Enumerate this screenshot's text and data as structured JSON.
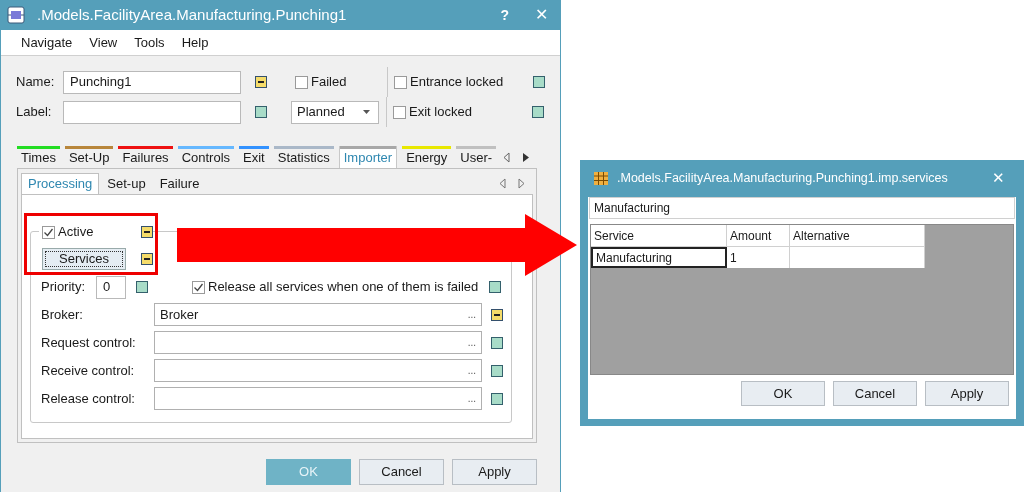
{
  "main_window": {
    "title": ".Models.FacilityArea.Manufacturing.Punching1",
    "help": "?",
    "close": "✕",
    "menu": [
      "Navigate",
      "View",
      "Tools",
      "Help"
    ],
    "name_field": {
      "label": "Name:",
      "value": "Punching1",
      "inherited": false
    },
    "label_field": {
      "label": "Label:",
      "inherited": true
    },
    "failed": {
      "label": "Failed",
      "checked": false
    },
    "state_dropdown": {
      "value": "Planned"
    },
    "entrance_locked": {
      "label": "Entrance locked",
      "checked": false,
      "inherited": true
    },
    "exit_locked": {
      "label": "Exit locked",
      "checked": false,
      "inherited": true
    },
    "tabs": [
      {
        "label": "Times",
        "color": "#22dd22",
        "selected": false
      },
      {
        "label": "Set-Up",
        "color": "#b8863b",
        "selected": false
      },
      {
        "label": "Failures",
        "color": "#ee1111",
        "selected": false
      },
      {
        "label": "Controls",
        "color": "#66b8ff",
        "selected": false
      },
      {
        "label": "Exit",
        "color": "#3392ff",
        "selected": false
      },
      {
        "label": "Statistics",
        "color": "#aab8c8",
        "selected": false
      },
      {
        "label": "Importer",
        "color": "#a8a8a8",
        "selected": true
      },
      {
        "label": "Energy",
        "color": "#e8e800",
        "selected": false
      },
      {
        "label": "User-",
        "color": "#c0c0c0",
        "selected": false
      }
    ],
    "subtabs": [
      {
        "label": "Processing",
        "selected": true
      },
      {
        "label": "Set-up",
        "selected": false
      },
      {
        "label": "Failure",
        "selected": false
      }
    ],
    "active": {
      "label": "Active",
      "checked": true,
      "inherited": false
    },
    "services_button": {
      "label": "Services",
      "inherited": false
    },
    "priority": {
      "label": "Priority:",
      "value": "0",
      "inherited": true
    },
    "release_all": {
      "label": "Release all services when one of them is failed",
      "checked": true,
      "inherited": true
    },
    "fields": [
      {
        "label": "Broker:",
        "value": "Broker",
        "browse": "...",
        "inherited": false
      },
      {
        "label": "Request control:",
        "browse": "...",
        "inherited": true
      },
      {
        "label": "Receive control:",
        "browse": "...",
        "inherited": true
      },
      {
        "label": "Release control:",
        "browse": "...",
        "inherited": true
      }
    ],
    "buttons": [
      {
        "label": "OK",
        "kind": "default"
      },
      {
        "label": "Cancel",
        "kind": "normal"
      },
      {
        "label": "Apply",
        "kind": "normal"
      }
    ]
  },
  "services_window": {
    "title": ".Models.FacilityArea.Manufacturing.Punching1.imp.services",
    "close": "✕",
    "path_field": {
      "value": "Manufacturing"
    },
    "table": {
      "columns": [
        "Service",
        "Amount",
        "Alternative"
      ],
      "rows": [
        {
          "cells": [
            {
              "text": "Manufacturing",
              "selected": true
            },
            {
              "text": "1",
              "selected": false
            },
            {
              "selected": false
            }
          ]
        }
      ]
    },
    "buttons": [
      {
        "label": "OK",
        "kind": "normal"
      },
      {
        "label": "Cancel",
        "kind": "normal"
      },
      {
        "label": "Apply",
        "kind": "normal"
      }
    ]
  }
}
